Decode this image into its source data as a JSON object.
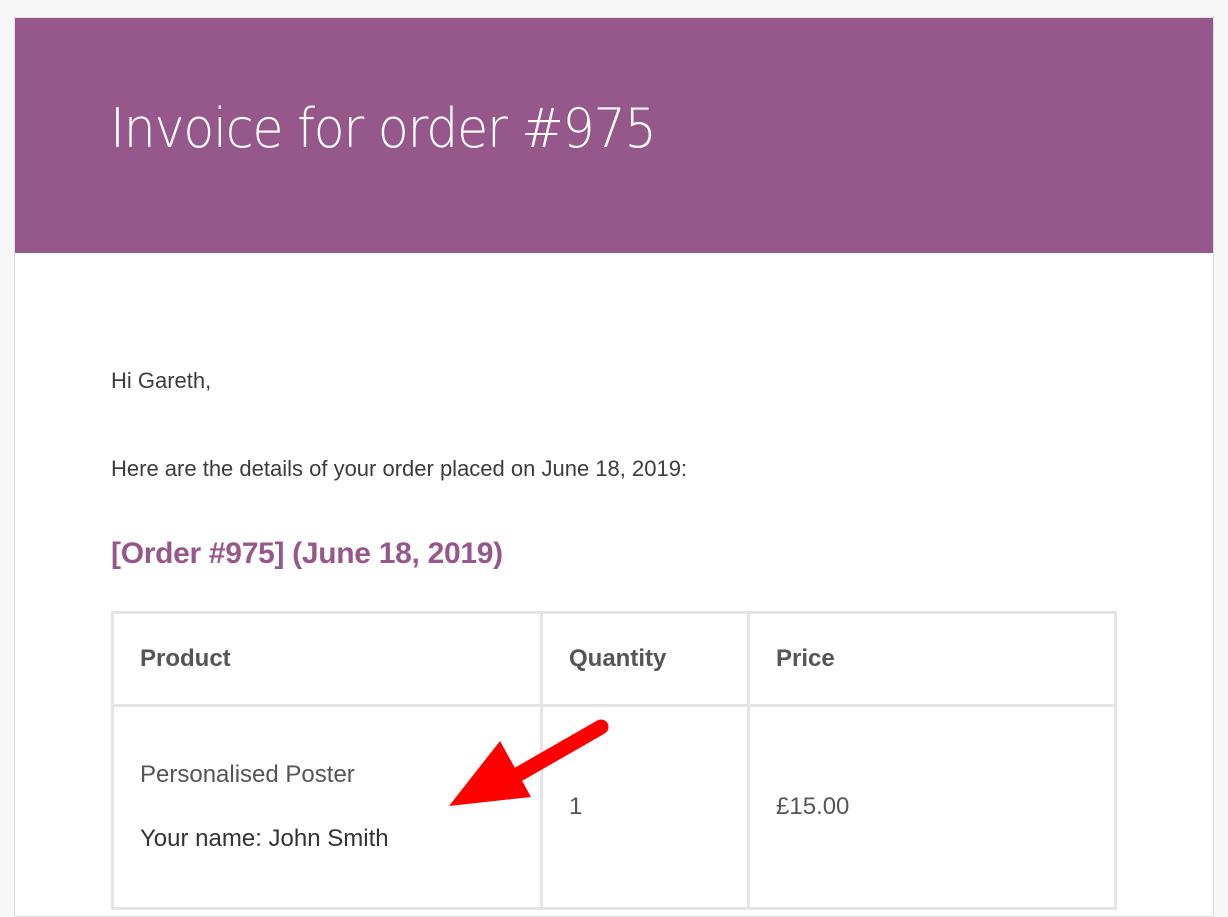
{
  "header": {
    "title": "Invoice for order #975",
    "background_color": "#96588a"
  },
  "body": {
    "greeting": "Hi Gareth,",
    "intro": "Here are the details of your order placed on June 18, 2019:",
    "order_heading": "[Order #975] (June 18, 2019)",
    "accent_color": "#96588a"
  },
  "table": {
    "headers": [
      "Product",
      "Quantity",
      "Price"
    ],
    "rows": [
      {
        "product": "Personalised Poster",
        "meta_label": "Your name:",
        "meta_value": "John Smith",
        "meta": "Your name: John Smith",
        "quantity": "1",
        "price": "£15.00"
      }
    ]
  },
  "annotation": {
    "icon": "red-arrow-icon",
    "color": "#ff0000"
  }
}
